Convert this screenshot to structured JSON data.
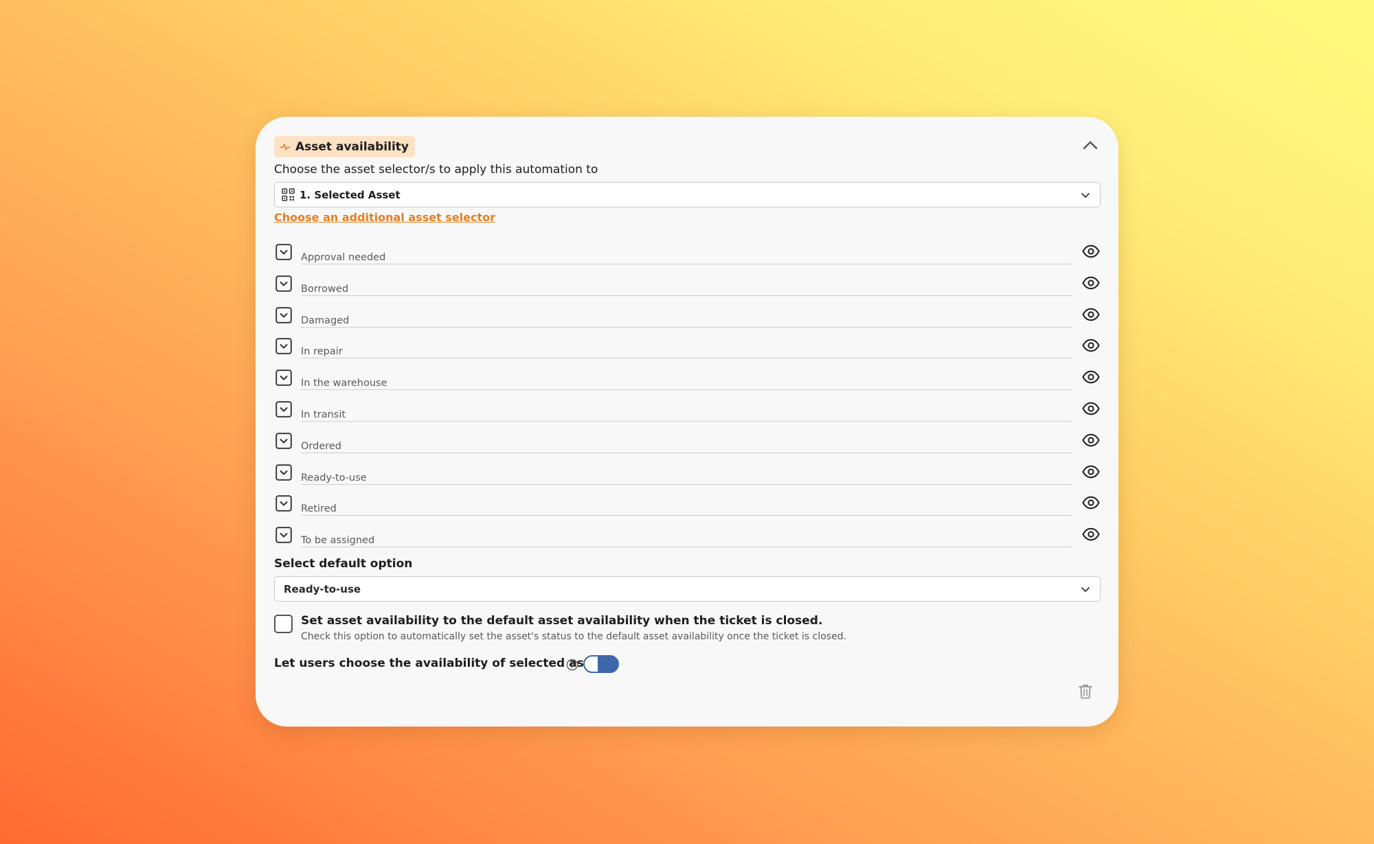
{
  "card": {
    "header": {
      "title": "Asset availability",
      "icon": "activity-pulse-icon",
      "accent_color": "#e67e22",
      "pill_color": "#fde2c3"
    },
    "collapse_icon": "chevron-up-icon",
    "selector_prompt": "Choose the asset selector/s to apply this automation to",
    "asset_selector": {
      "value": "1. Selected Asset",
      "icon": "qr-code-icon"
    },
    "additional_selector_link": "Choose an additional asset selector",
    "statuses": [
      {
        "label": "Approval needed"
      },
      {
        "label": "Borrowed"
      },
      {
        "label": "Damaged"
      },
      {
        "label": "In repair"
      },
      {
        "label": "In the warehouse"
      },
      {
        "label": "In transit"
      },
      {
        "label": "Ordered"
      },
      {
        "label": "Ready-to-use"
      },
      {
        "label": "Retired"
      },
      {
        "label": "To be assigned"
      }
    ],
    "default_option": {
      "title": "Select default option",
      "value": "Ready-to-use"
    },
    "close_option": {
      "checked": false,
      "title": "Set asset availability to the default asset availability when the ticket is closed.",
      "help": "Check this option to automatically set the asset's status to the default asset availability once the ticket is closed."
    },
    "user_choice": {
      "label": "Let users choose the availability of selected assets",
      "enabled": true,
      "toggle_color": "#3f67a8"
    },
    "delete_icon": "trash-icon"
  }
}
